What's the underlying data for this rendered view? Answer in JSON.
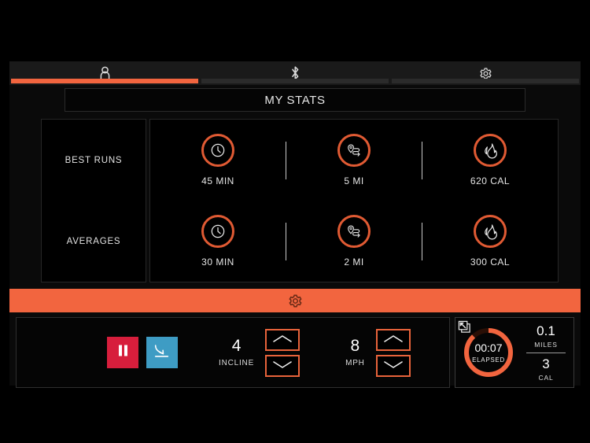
{
  "theme": {
    "accent": "#f2653f",
    "ring": "#e05a33",
    "pause_red": "#d71e3c",
    "finish_blue": "#3e9cc4",
    "background": "#000000",
    "panel": "#0a0a0a"
  },
  "tabs": [
    {
      "icon": "user-icon",
      "active": true
    },
    {
      "icon": "bluetooth-icon",
      "active": false
    },
    {
      "icon": "gear-icon",
      "active": false
    }
  ],
  "header": {
    "title": "MY STATS"
  },
  "stats": {
    "row_labels": [
      "BEST RUNS",
      "AVERAGES"
    ],
    "rows": [
      {
        "label": "BEST RUNS",
        "cells": [
          {
            "icon": "clock-icon",
            "value": "45 MIN"
          },
          {
            "icon": "route-pin-icon",
            "value": "5 MI"
          },
          {
            "icon": "flame-icon",
            "value": "620 CAL"
          }
        ]
      },
      {
        "label": "AVERAGES",
        "cells": [
          {
            "icon": "clock-icon",
            "value": "30 MIN"
          },
          {
            "icon": "route-pin-icon",
            "value": "2 MI"
          },
          {
            "icon": "flame-icon",
            "value": "300 CAL"
          }
        ]
      }
    ]
  },
  "settings_bar": {
    "icon": "gear-icon"
  },
  "console": {
    "pause_button": {
      "icon": "pause-icon"
    },
    "finish_button": {
      "icon": "finish-arrow-icon"
    },
    "incline": {
      "value": "4",
      "unit": "INCLINE",
      "up_icon": "chevron-up-icon",
      "down_icon": "chevron-down-icon"
    },
    "speed": {
      "value": "8",
      "unit": "MPH",
      "up_icon": "chevron-up-icon",
      "down_icon": "chevron-down-icon"
    },
    "minimize": {
      "icon": "collapse-icon"
    },
    "timer": {
      "value": "00:07",
      "label": "ELAPSED",
      "progress_percent": 88
    },
    "readouts": [
      {
        "value": "0.1",
        "unit": "MILES"
      },
      {
        "value": "3",
        "unit": "CAL"
      }
    ]
  }
}
